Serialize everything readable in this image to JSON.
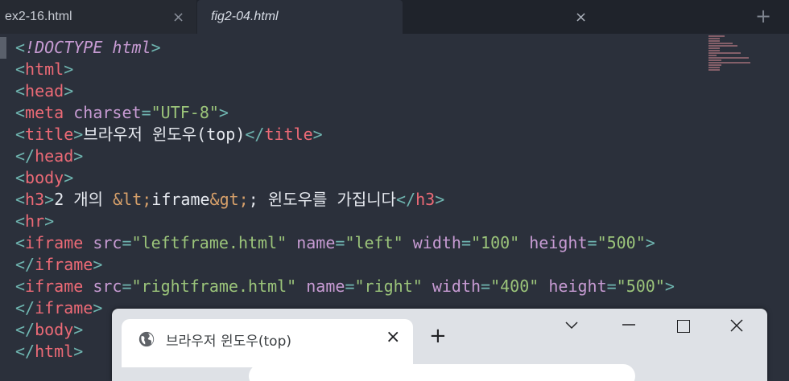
{
  "editor_tabs": [
    {
      "name": "ex2-16.html",
      "active": false
    },
    {
      "name": "fig2-04.html",
      "active": true
    }
  ],
  "icons": {
    "tab_close": "×",
    "new_tab": "+",
    "browser_close": "×",
    "browser_new_tab": "+"
  },
  "code_lines": [
    [
      [
        "p",
        "<"
      ],
      [
        "d",
        "!DOCTYPE"
      ],
      [
        "x",
        " "
      ],
      [
        "d",
        "html"
      ],
      [
        "p",
        ">"
      ]
    ],
    [
      [
        "p",
        "<"
      ],
      [
        "t",
        "html"
      ],
      [
        "p",
        ">"
      ]
    ],
    [
      [
        "p",
        "<"
      ],
      [
        "t",
        "head"
      ],
      [
        "p",
        ">"
      ]
    ],
    [
      [
        "p",
        "<"
      ],
      [
        "t",
        "meta"
      ],
      [
        "x",
        " "
      ],
      [
        "a",
        "charset"
      ],
      [
        "o",
        "="
      ],
      [
        "s",
        "\"UTF-8\""
      ],
      [
        "p",
        ">"
      ]
    ],
    [
      [
        "p",
        "<"
      ],
      [
        "t",
        "title"
      ],
      [
        "p",
        ">"
      ],
      [
        "x",
        "브라우저 윈도우(top)"
      ],
      [
        "p",
        "</"
      ],
      [
        "t",
        "title"
      ],
      [
        "p",
        ">"
      ]
    ],
    [
      [
        "p",
        "</"
      ],
      [
        "t",
        "head"
      ],
      [
        "p",
        ">"
      ]
    ],
    [
      [
        "p",
        "<"
      ],
      [
        "t",
        "body"
      ],
      [
        "p",
        ">"
      ]
    ],
    [
      [
        "p",
        "<"
      ],
      [
        "t",
        "h3"
      ],
      [
        "p",
        ">"
      ],
      [
        "x",
        "2 개의 "
      ],
      [
        "e",
        "&lt;"
      ],
      [
        "x",
        "iframe"
      ],
      [
        "e",
        "&gt;"
      ],
      [
        "x",
        "; 윈도우를 가집니다"
      ],
      [
        "p",
        "</"
      ],
      [
        "t",
        "h3"
      ],
      [
        "p",
        ">"
      ]
    ],
    [
      [
        "p",
        "<"
      ],
      [
        "t",
        "hr"
      ],
      [
        "p",
        ">"
      ]
    ],
    [
      [
        "p",
        "<"
      ],
      [
        "t",
        "iframe"
      ],
      [
        "x",
        " "
      ],
      [
        "a",
        "src"
      ],
      [
        "o",
        "="
      ],
      [
        "s",
        "\"leftframe.html\""
      ],
      [
        "x",
        " "
      ],
      [
        "a",
        "name"
      ],
      [
        "o",
        "="
      ],
      [
        "s",
        "\"left\""
      ],
      [
        "x",
        " "
      ],
      [
        "a",
        "width"
      ],
      [
        "o",
        "="
      ],
      [
        "s",
        "\"100\""
      ],
      [
        "x",
        " "
      ],
      [
        "a",
        "height"
      ],
      [
        "o",
        "="
      ],
      [
        "s",
        "\"500\""
      ],
      [
        "p",
        ">"
      ]
    ],
    [
      [
        "p",
        "</"
      ],
      [
        "t",
        "iframe"
      ],
      [
        "p",
        ">"
      ]
    ],
    [
      [
        "p",
        "<"
      ],
      [
        "t",
        "iframe"
      ],
      [
        "x",
        " "
      ],
      [
        "a",
        "src"
      ],
      [
        "o",
        "="
      ],
      [
        "s",
        "\"rightframe.html\""
      ],
      [
        "x",
        " "
      ],
      [
        "a",
        "name"
      ],
      [
        "o",
        "="
      ],
      [
        "s",
        "\"right\""
      ],
      [
        "x",
        " "
      ],
      [
        "a",
        "width"
      ],
      [
        "o",
        "="
      ],
      [
        "s",
        "\"400\""
      ],
      [
        "x",
        " "
      ],
      [
        "a",
        "height"
      ],
      [
        "o",
        "="
      ],
      [
        "s",
        "\"500\""
      ],
      [
        "p",
        ">"
      ]
    ],
    [
      [
        "p",
        "</"
      ],
      [
        "t",
        "iframe"
      ],
      [
        "p",
        ">"
      ]
    ],
    [
      [
        "p",
        "</"
      ],
      [
        "t",
        "body"
      ],
      [
        "p",
        ">"
      ]
    ],
    [
      [
        "p",
        "</"
      ],
      [
        "t",
        "html"
      ],
      [
        "p",
        ">"
      ]
    ]
  ],
  "browser": {
    "tab_title": "브라우저 윈도우(top)"
  },
  "colors": {
    "editor_bg": "#2b303b",
    "tag": "#ec6a76",
    "attribute": "#c79bd3",
    "string": "#9bc47a",
    "punctuation": "#6fb5b0"
  }
}
